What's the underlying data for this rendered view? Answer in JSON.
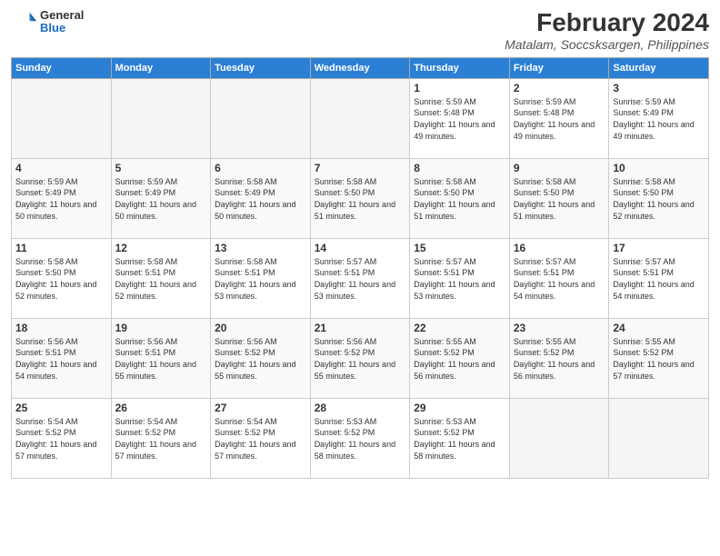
{
  "logo": {
    "general": "General",
    "blue": "Blue"
  },
  "title": "February 2024",
  "subtitle": "Matalam, Soccsksargen, Philippines",
  "days_of_week": [
    "Sunday",
    "Monday",
    "Tuesday",
    "Wednesday",
    "Thursday",
    "Friday",
    "Saturday"
  ],
  "weeks": [
    [
      {
        "day": "",
        "empty": true
      },
      {
        "day": "",
        "empty": true
      },
      {
        "day": "",
        "empty": true
      },
      {
        "day": "",
        "empty": true
      },
      {
        "day": "1",
        "sunrise": "5:59 AM",
        "sunset": "5:48 PM",
        "daylight": "11 hours and 49 minutes."
      },
      {
        "day": "2",
        "sunrise": "5:59 AM",
        "sunset": "5:48 PM",
        "daylight": "11 hours and 49 minutes."
      },
      {
        "day": "3",
        "sunrise": "5:59 AM",
        "sunset": "5:49 PM",
        "daylight": "11 hours and 49 minutes."
      }
    ],
    [
      {
        "day": "4",
        "sunrise": "5:59 AM",
        "sunset": "5:49 PM",
        "daylight": "11 hours and 50 minutes."
      },
      {
        "day": "5",
        "sunrise": "5:59 AM",
        "sunset": "5:49 PM",
        "daylight": "11 hours and 50 minutes."
      },
      {
        "day": "6",
        "sunrise": "5:58 AM",
        "sunset": "5:49 PM",
        "daylight": "11 hours and 50 minutes."
      },
      {
        "day": "7",
        "sunrise": "5:58 AM",
        "sunset": "5:50 PM",
        "daylight": "11 hours and 51 minutes."
      },
      {
        "day": "8",
        "sunrise": "5:58 AM",
        "sunset": "5:50 PM",
        "daylight": "11 hours and 51 minutes."
      },
      {
        "day": "9",
        "sunrise": "5:58 AM",
        "sunset": "5:50 PM",
        "daylight": "11 hours and 51 minutes."
      },
      {
        "day": "10",
        "sunrise": "5:58 AM",
        "sunset": "5:50 PM",
        "daylight": "11 hours and 52 minutes."
      }
    ],
    [
      {
        "day": "11",
        "sunrise": "5:58 AM",
        "sunset": "5:50 PM",
        "daylight": "11 hours and 52 minutes."
      },
      {
        "day": "12",
        "sunrise": "5:58 AM",
        "sunset": "5:51 PM",
        "daylight": "11 hours and 52 minutes."
      },
      {
        "day": "13",
        "sunrise": "5:58 AM",
        "sunset": "5:51 PM",
        "daylight": "11 hours and 53 minutes."
      },
      {
        "day": "14",
        "sunrise": "5:57 AM",
        "sunset": "5:51 PM",
        "daylight": "11 hours and 53 minutes."
      },
      {
        "day": "15",
        "sunrise": "5:57 AM",
        "sunset": "5:51 PM",
        "daylight": "11 hours and 53 minutes."
      },
      {
        "day": "16",
        "sunrise": "5:57 AM",
        "sunset": "5:51 PM",
        "daylight": "11 hours and 54 minutes."
      },
      {
        "day": "17",
        "sunrise": "5:57 AM",
        "sunset": "5:51 PM",
        "daylight": "11 hours and 54 minutes."
      }
    ],
    [
      {
        "day": "18",
        "sunrise": "5:56 AM",
        "sunset": "5:51 PM",
        "daylight": "11 hours and 54 minutes."
      },
      {
        "day": "19",
        "sunrise": "5:56 AM",
        "sunset": "5:51 PM",
        "daylight": "11 hours and 55 minutes."
      },
      {
        "day": "20",
        "sunrise": "5:56 AM",
        "sunset": "5:52 PM",
        "daylight": "11 hours and 55 minutes."
      },
      {
        "day": "21",
        "sunrise": "5:56 AM",
        "sunset": "5:52 PM",
        "daylight": "11 hours and 55 minutes."
      },
      {
        "day": "22",
        "sunrise": "5:55 AM",
        "sunset": "5:52 PM",
        "daylight": "11 hours and 56 minutes."
      },
      {
        "day": "23",
        "sunrise": "5:55 AM",
        "sunset": "5:52 PM",
        "daylight": "11 hours and 56 minutes."
      },
      {
        "day": "24",
        "sunrise": "5:55 AM",
        "sunset": "5:52 PM",
        "daylight": "11 hours and 57 minutes."
      }
    ],
    [
      {
        "day": "25",
        "sunrise": "5:54 AM",
        "sunset": "5:52 PM",
        "daylight": "11 hours and 57 minutes."
      },
      {
        "day": "26",
        "sunrise": "5:54 AM",
        "sunset": "5:52 PM",
        "daylight": "11 hours and 57 minutes."
      },
      {
        "day": "27",
        "sunrise": "5:54 AM",
        "sunset": "5:52 PM",
        "daylight": "11 hours and 57 minutes."
      },
      {
        "day": "28",
        "sunrise": "5:53 AM",
        "sunset": "5:52 PM",
        "daylight": "11 hours and 58 minutes."
      },
      {
        "day": "29",
        "sunrise": "5:53 AM",
        "sunset": "5:52 PM",
        "daylight": "11 hours and 58 minutes."
      },
      {
        "day": "",
        "empty": true
      },
      {
        "day": "",
        "empty": true
      }
    ]
  ],
  "labels": {
    "sunrise_prefix": "Sunrise: ",
    "sunset_prefix": "Sunset: ",
    "daylight_prefix": "Daylight: "
  }
}
